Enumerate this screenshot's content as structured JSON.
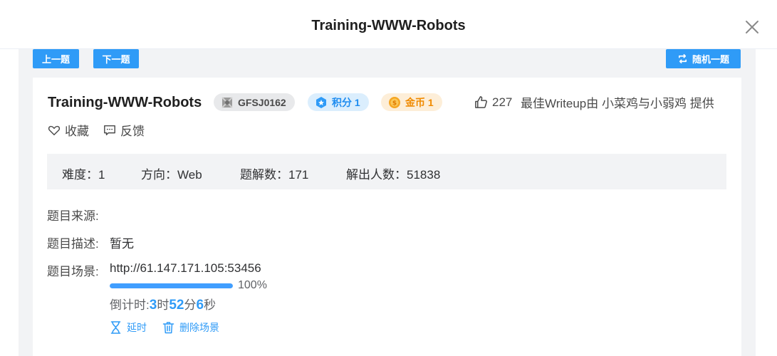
{
  "dialog": {
    "title": "Training-WWW-Robots"
  },
  "nav": {
    "prev_label": "上一题",
    "next_label": "下一题",
    "random_label": "随机一题"
  },
  "challenge": {
    "title": "Training-WWW-Robots",
    "id_tag": "GFSJ0162",
    "score_tag": "积分 1",
    "coin_tag": "金币 1",
    "likes": "227",
    "writeup_text": "最佳Writeup由 小菜鸡与小弱鸡 提供",
    "favorite_label": "收藏",
    "feedback_label": "反馈"
  },
  "stats": {
    "difficulty": "难度：1",
    "direction": "方向：Web",
    "solutions": "题解数：171",
    "solvers": "解出人数：51838"
  },
  "fields": {
    "source_label": "题目来源:",
    "source_value": "",
    "description_label": "题目描述:",
    "description_value": "暂无",
    "scene_label": "题目场景:",
    "scene_url": "http://61.147.171.105:53456"
  },
  "progress": {
    "value": 100,
    "text": "100%"
  },
  "countdown": {
    "prefix": "倒计时: ",
    "hours": "3",
    "hours_unit": "时",
    "minutes": "52",
    "minutes_unit": "分",
    "seconds": "6",
    "seconds_unit": "秒"
  },
  "scene_actions": {
    "extend_label": "延时",
    "delete_label": "删除场景"
  },
  "colors": {
    "accent": "#2f9bf7",
    "score_tag_bg": "#dbeefd",
    "coin_tag_bg": "#fdeed8",
    "panel_bg": "#f2f3f5"
  }
}
